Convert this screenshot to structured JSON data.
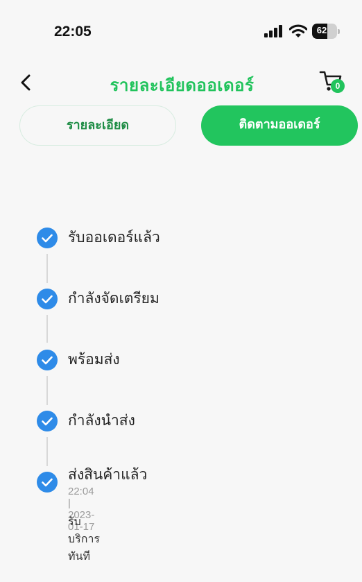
{
  "status_bar": {
    "time": "22:05",
    "battery": "62",
    "battery_level": 0.62,
    "icons": [
      "signal-icon",
      "wifi-icon",
      "battery-icon"
    ]
  },
  "header": {
    "title": "รายละเอียดออเดอร์",
    "back_icon": "chevron-left-icon",
    "cart_icon": "cart-icon",
    "cart_count": "0"
  },
  "tabs": [
    {
      "label": "รายละเอียด",
      "active": false
    },
    {
      "label": "ติดตามออเดอร์",
      "active": true
    }
  ],
  "timeline": {
    "steps": [
      {
        "label": "รับออเดอร์แล้ว",
        "done": true
      },
      {
        "label": "กำลังจัดเตรียม",
        "done": true
      },
      {
        "label": "พร้อมส่ง",
        "done": true
      },
      {
        "label": "กำลังนำส่ง",
        "done": true
      },
      {
        "label": "ส่งสินค้าแล้ว",
        "done": true,
        "time": "22:04 | 2023-01-17",
        "note": "รับบริการทันที"
      }
    ]
  },
  "colors": {
    "accent": "#22c55e",
    "check": "#2e8be8",
    "background": "#f7f7f7"
  }
}
